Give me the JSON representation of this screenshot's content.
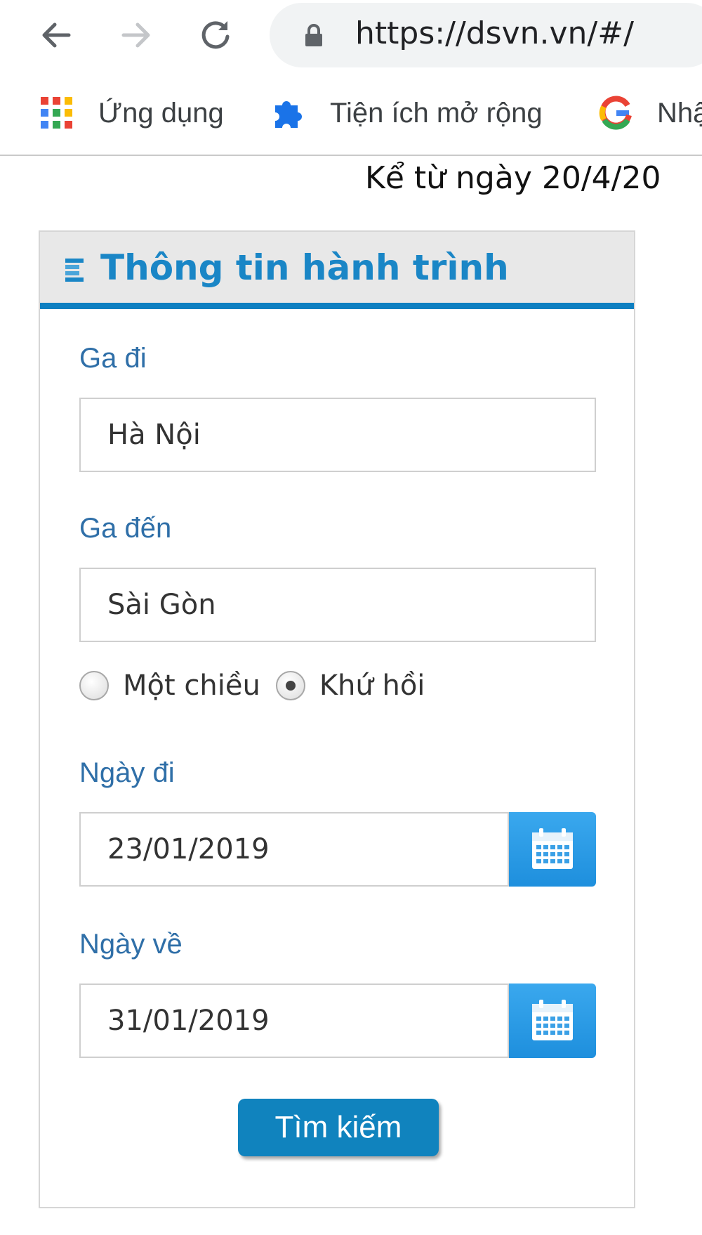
{
  "browser": {
    "url": "https://dsvn.vn/#/",
    "bookmarks": [
      {
        "label": "Ứng dụng",
        "icon": "apps-grid-icon"
      },
      {
        "label": "Tiện ích mở rộng",
        "icon": "puzzle-extension-icon"
      },
      {
        "label": "Nhậ",
        "icon": "google-g-icon"
      }
    ]
  },
  "notice": "Kể từ ngày 20/4/20",
  "panel": {
    "title": "Thông tin hành trình",
    "from_label": "Ga đi",
    "from_value": "Hà Nội",
    "to_label": "Ga đến",
    "to_value": "Sài Gòn",
    "trip_options": [
      {
        "label": "Một chiều",
        "checked": false
      },
      {
        "label": "Khứ hồi",
        "checked": true
      }
    ],
    "depart_label": "Ngày đi",
    "depart_value": "23/01/2019",
    "return_label": "Ngày về",
    "return_value": "31/01/2019",
    "search_label": "Tìm kiếm"
  },
  "colors": {
    "accent": "#1a86c6",
    "header_bar": "#0d7fc1",
    "label": "#2f6fa8",
    "button": "#1083be"
  }
}
